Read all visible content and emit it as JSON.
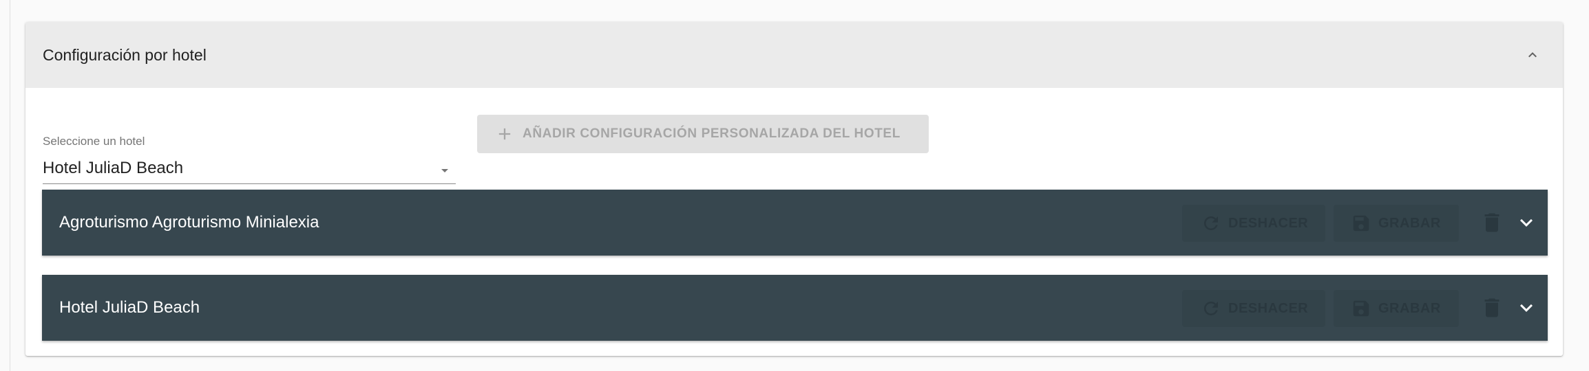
{
  "panel": {
    "title": "Configuración por hotel",
    "collapse_icon": "chevron-up-icon"
  },
  "hotel_select": {
    "label": "Seleccione un hotel",
    "value": "Hotel JuliaD Beach",
    "icon": "dropdown-arrow-icon"
  },
  "add_button": {
    "label": "Añadir configuración personalizada del hotel",
    "icon": "plus-icon",
    "disabled": true
  },
  "hotels": [
    {
      "name": "Agroturismo Agroturismo Minialexia",
      "undo_label": "Deshacer",
      "save_label": "Grabar"
    },
    {
      "name": "Hotel JuliaD Beach",
      "undo_label": "Deshacer",
      "save_label": "Grabar"
    }
  ],
  "colors": {
    "panel_header_bg": "#ebebeb",
    "hotel_row_bg": "#37474f",
    "disabled_button_bg": "#e0e0e0",
    "disabled_text": "#a6a6a6"
  }
}
